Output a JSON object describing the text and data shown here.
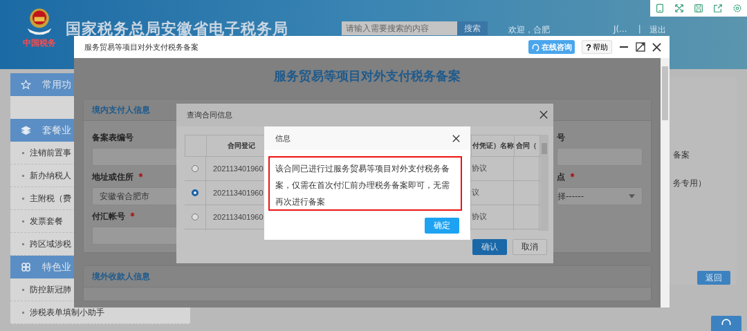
{
  "header": {
    "logo_text": "中国税务",
    "title": "国家税务总局安徽省电子税务局",
    "search": {
      "placeholder": "请输入需要搜索的内容"
    },
    "search_button": "搜索",
    "welcome": "欢迎，合肥",
    "user": "J(...",
    "separator": "|",
    "logout": "退出"
  },
  "sidebar": {
    "sections": [
      {
        "title": "常用功"
      },
      {
        "title": "套餐业",
        "items": [
          "注销前置事",
          "新办纳税人",
          "主附税（费",
          "发票套餐",
          "跨区域涉税"
        ]
      },
      {
        "title": "特色业",
        "items": [
          "防控新冠肺",
          "涉税表单填制小助手"
        ]
      }
    ]
  },
  "background_panel": {
    "texts": [
      "备案",
      "务专用）"
    ],
    "back_button": "返回"
  },
  "main_window": {
    "title": "服务贸易等项目对外支付税务备案",
    "consult_button": "在线咨询",
    "help_mark": "?",
    "help_button": "帮助",
    "heading": "服务贸易等项目对外支付税务备案",
    "payer_section": {
      "title": "境内支付人信息",
      "left_fields": [
        {
          "label": "备案表编号",
          "required": false,
          "kind": "input"
        },
        {
          "label": "地址或住所",
          "required": true,
          "kind": "input",
          "value": "安徽省合肥市"
        },
        {
          "label": "付汇帐号",
          "required": true,
          "kind": "input"
        }
      ],
      "right_fields": [
        {
          "label": "号",
          "required": false,
          "kind": "input"
        },
        {
          "label": "点",
          "required": true,
          "kind": "select",
          "value": "择------"
        }
      ]
    },
    "payee_section": {
      "title": "境外收款人信息"
    }
  },
  "contract_dialog": {
    "title": "查询合同信息",
    "columns": [
      "合同登记",
      "付凭证）名称",
      "合同（"
    ],
    "rows": [
      {
        "selected": false,
        "cells": [
          "202113401960",
          "协议"
        ]
      },
      {
        "selected": true,
        "cells": [
          "202113401960",
          "议"
        ]
      },
      {
        "selected": false,
        "cells": [
          "202113401960",
          "协议"
        ]
      }
    ],
    "confirm_button": "确认",
    "cancel_button": "取消"
  },
  "info_dialog": {
    "title": "信息",
    "message": "该合同已进行过服务贸易等项目对外支付税务备案，仅需在首次付汇前办理税务备案即可，无需再次进行备案",
    "ok_button": "确定"
  }
}
